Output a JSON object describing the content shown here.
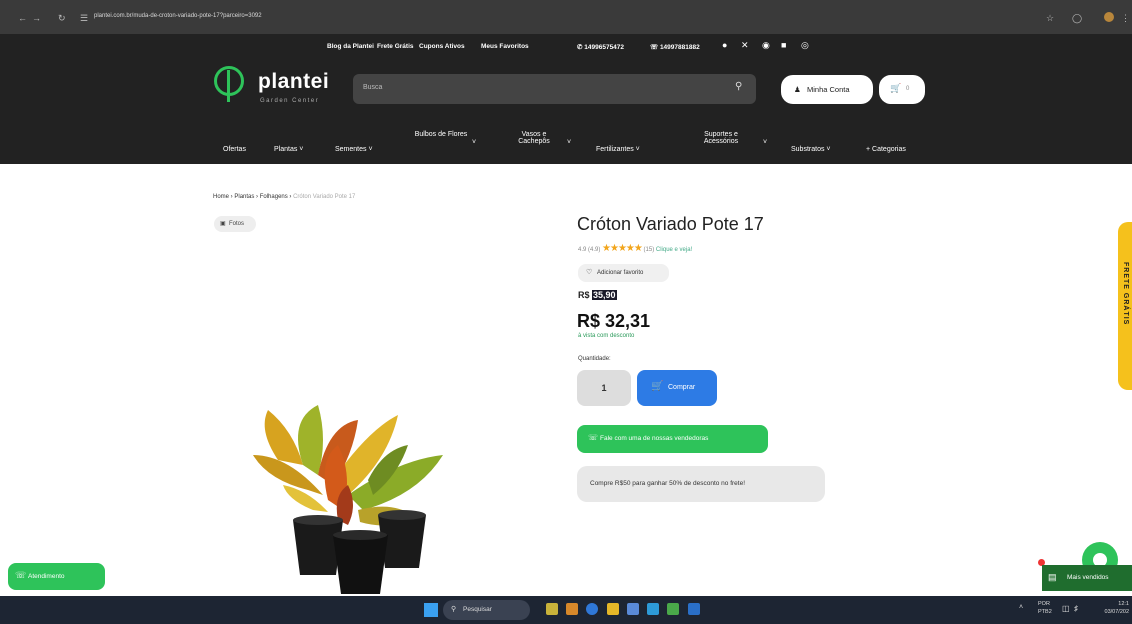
{
  "browser": {
    "url": "plantei.com.br/muda-de-croton-variado-pote-17?parceiro=3092"
  },
  "header": {
    "toplinks": [
      "Blog da Plantei",
      "Frete Grátis",
      "Cupons Ativos",
      "Meus Favoritos"
    ],
    "phone1": "14996575472",
    "phone2": "14997881882",
    "logo_text": "plantei",
    "logo_sub": "Garden Center",
    "search_placeholder": "Busca",
    "account_label": "Minha Conta",
    "cart_count": "0",
    "menu": [
      {
        "label": "Ofertas"
      },
      {
        "label": "Plantas"
      },
      {
        "label": "Sementes"
      },
      {
        "label": "Bulbos de Flores"
      },
      {
        "label": "Vasos e Cachepôs"
      },
      {
        "label": "Fertilizantes"
      },
      {
        "label": "Suportes e Acessórios"
      },
      {
        "label": "Substratos"
      },
      {
        "label": "+ Categorias"
      }
    ]
  },
  "breadcrumb": [
    "Home",
    "Plantas",
    "Folhagens",
    "Cróton Variado Pote 17"
  ],
  "product": {
    "fotos_label": "Fotos",
    "title": "Cróton Variado Pote 17",
    "rating_value": "4.9 (4.9)",
    "rating_count": "(15)",
    "rating_link": "Clique e veja!",
    "fav_label": "Adicionar favorito",
    "old_price_prefix": "R$",
    "old_price_value": "35,90",
    "new_price": "R$ 32,31",
    "price_note": "à vista com desconto",
    "qty_label": "Quantidade:",
    "qty_value": "1",
    "buy_label": "Comprar",
    "whats_label": "Fale com uma de nossas vendedoras",
    "promo_text": "Compre R$50 para ganhar 50% de desconto no frete!"
  },
  "floating": {
    "frete_tab": "FRETE GRÁTIS",
    "atendimento": "Atendimento",
    "mais_vendidos": "Mais vendidos"
  },
  "taskbar": {
    "search_label": "Pesquisar",
    "lang": "POR",
    "lang2": "PTB2",
    "time": "12:1",
    "date": "03/07/202"
  },
  "colors": {
    "brand_green": "#2ec35a",
    "buy_blue": "#2d7be5",
    "header_bg": "#222222",
    "frete_yellow": "#f5c11c",
    "stars": "#f2a51c"
  }
}
